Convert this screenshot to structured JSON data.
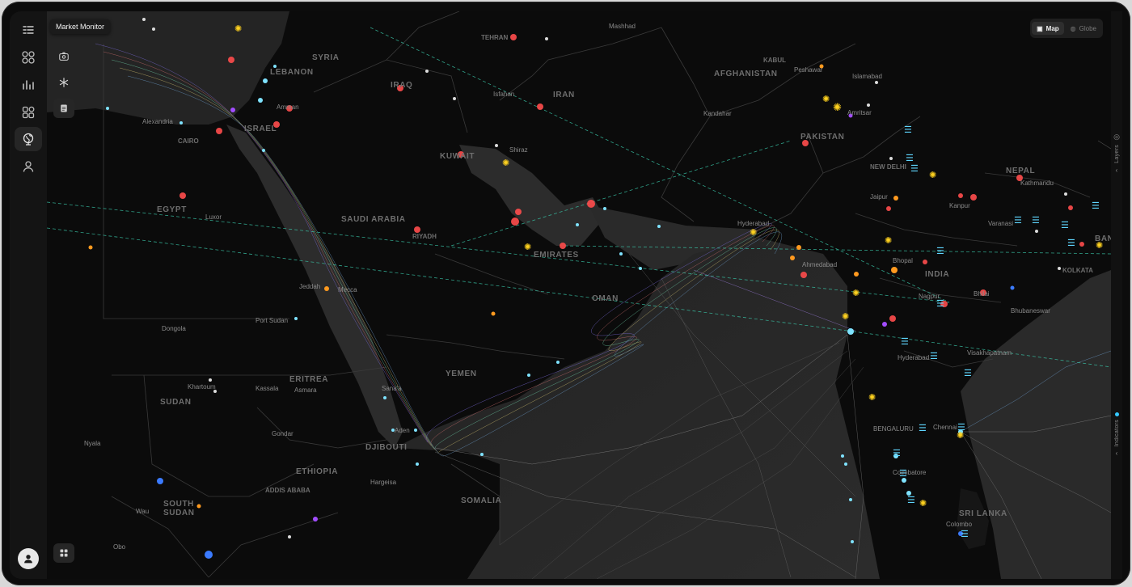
{
  "app": {
    "tooltip": "Market Monitor"
  },
  "view_toggle": {
    "map_label": "Map",
    "globe_label": "Globe",
    "active": "Map"
  },
  "side_panels": {
    "layers_label": "Layers",
    "indicators_label": "Indicators"
  },
  "colors": {
    "accent": "#35c8ff",
    "event_red": "#ff4d4d",
    "orange": "#ff9a1f",
    "purple": "#a24dff",
    "gold": "#ffd21f",
    "teal_line": "#39c6a8"
  },
  "rail_icons": [
    "menu-collapse-icon",
    "grid-apps-icon",
    "chart-activity-icon",
    "dashboard-icon",
    "globe-icon",
    "user-icon"
  ],
  "tools": [
    "camera-icon",
    "asterisk-icon",
    "document-icon",
    "grid-icon"
  ],
  "map_labels": {
    "countries": [
      {
        "id": "syria",
        "text": "SYRIA"
      },
      {
        "id": "iraq",
        "text": "IRAQ"
      },
      {
        "id": "iran",
        "text": "IRAN"
      },
      {
        "id": "afghanistan",
        "text": "AFGHANISTAN"
      },
      {
        "id": "pakistan",
        "text": "PAKISTAN"
      },
      {
        "id": "nepal",
        "text": "NEPAL"
      },
      {
        "id": "egypt",
        "text": "EGYPT"
      },
      {
        "id": "saudi",
        "text": "SAUDI ARABIA"
      },
      {
        "id": "india",
        "text": "INDIA"
      },
      {
        "id": "yemen",
        "text": "YEMEN"
      },
      {
        "id": "oman",
        "text": "OMAN"
      },
      {
        "id": "eritrea",
        "text": "ERITREA"
      },
      {
        "id": "sudan",
        "text": "SUDAN"
      },
      {
        "id": "ethiopia",
        "text": "ETHIOPIA"
      },
      {
        "id": "somalia",
        "text": "SOMALIA"
      },
      {
        "id": "south_sudan",
        "text": "SOUTH SUDAN"
      },
      {
        "id": "israel",
        "text": "ISRAEL"
      },
      {
        "id": "lebanon",
        "text": "LEBANON"
      },
      {
        "id": "emirates",
        "text": "EMIRATES"
      },
      {
        "id": "kuwait",
        "text": "KUWAIT"
      },
      {
        "id": "djibouti",
        "text": "DJIBOUTI"
      },
      {
        "id": "sri_lanka",
        "text": "SRI LANKA"
      },
      {
        "id": "bangladesh",
        "text": "BANG"
      }
    ],
    "cities": [
      {
        "id": "tehran",
        "text": "TEHRAN"
      },
      {
        "id": "mashhad",
        "text": "Mashhad"
      },
      {
        "id": "kabul",
        "text": "KABUL"
      },
      {
        "id": "peshawar",
        "text": "Peshawar"
      },
      {
        "id": "islamabad",
        "text": "Islamabad"
      },
      {
        "id": "isfahan",
        "text": "Isfahan"
      },
      {
        "id": "kandahar",
        "text": "Kandahar"
      },
      {
        "id": "amritsar",
        "text": "Amritsar"
      },
      {
        "id": "shiraz",
        "text": "Shiraz"
      },
      {
        "id": "new_delhi",
        "text": "NEW DELHI"
      },
      {
        "id": "kathmandu",
        "text": "Kathmandu"
      },
      {
        "id": "jaipur",
        "text": "Jaipur"
      },
      {
        "id": "kanpur",
        "text": "Kanpur"
      },
      {
        "id": "varanasi",
        "text": "Varanasi"
      },
      {
        "id": "riyadh",
        "text": "RIYADH"
      },
      {
        "id": "hyderabad_pk",
        "text": "Hyderabad"
      },
      {
        "id": "ahmedabad",
        "text": "Ahmedabad"
      },
      {
        "id": "bhopal",
        "text": "Bhopal"
      },
      {
        "id": "kolkata",
        "text": "KOLKATA"
      },
      {
        "id": "nagpur",
        "text": "Nagpur"
      },
      {
        "id": "bhilai",
        "text": "Bhilai"
      },
      {
        "id": "bhubaneswar",
        "text": "Bhubaneswar"
      },
      {
        "id": "hyderabad_in",
        "text": "Hyderabad"
      },
      {
        "id": "visakhapatnam",
        "text": "Visakhapatnam"
      },
      {
        "id": "bengaluru",
        "text": "BENGALURU"
      },
      {
        "id": "chennai",
        "text": "Chennai"
      },
      {
        "id": "coimbatore",
        "text": "Coimbatore"
      },
      {
        "id": "colombo",
        "text": "Colombo"
      },
      {
        "id": "cairo",
        "text": "CAIRO"
      },
      {
        "id": "alexandria",
        "text": "Alexandria"
      },
      {
        "id": "amman",
        "text": "Amman"
      },
      {
        "id": "luxor",
        "text": "Luxor"
      },
      {
        "id": "mecca",
        "text": "Mecca"
      },
      {
        "id": "jeddah",
        "text": "Jeddah"
      },
      {
        "id": "port_sudan",
        "text": "Port Sudan"
      },
      {
        "id": "dongola",
        "text": "Dongola"
      },
      {
        "id": "khartoum",
        "text": "Khartoum"
      },
      {
        "id": "kassala",
        "text": "Kassala"
      },
      {
        "id": "asmara",
        "text": "Asmara"
      },
      {
        "id": "sanaa",
        "text": "Sana'a"
      },
      {
        "id": "aden",
        "text": "Aden"
      },
      {
        "id": "gondar",
        "text": "Gondar"
      },
      {
        "id": "nyala",
        "text": "Nyala"
      },
      {
        "id": "addis",
        "text": "ADDIS ABABA"
      },
      {
        "id": "hargeisa",
        "text": "Hargeisa"
      },
      {
        "id": "wau",
        "text": "Wau"
      },
      {
        "id": "obo",
        "text": "Obo"
      }
    ]
  }
}
